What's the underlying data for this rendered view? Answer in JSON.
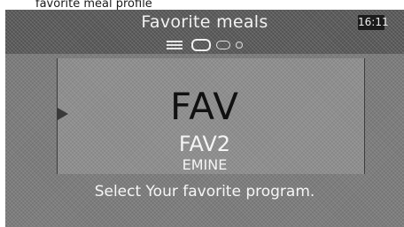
{
  "caption": "favorite meal profile",
  "header": {
    "title": "Favorite meals",
    "time": "16:11"
  },
  "indicators": {
    "menu_icon": "menu-icon",
    "page_count": 3,
    "active_page": 1
  },
  "program_list": {
    "current": "FAV",
    "next": "FAV2",
    "third": "EMINE"
  },
  "instruction": "Select Your favorite program."
}
